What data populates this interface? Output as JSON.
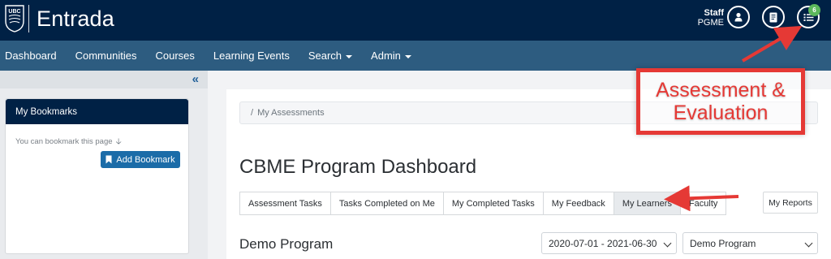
{
  "header": {
    "logo_text": "UBC",
    "brand": "Entrada",
    "user_name": "Staff",
    "user_role": "PGME",
    "notification_count": "6",
    "icons": [
      "user-icon",
      "document-icon",
      "task-list-icon"
    ]
  },
  "nav": {
    "items": [
      {
        "label": "Dashboard"
      },
      {
        "label": "Communities"
      },
      {
        "label": "Courses"
      },
      {
        "label": "Learning Events"
      },
      {
        "label": "Search",
        "dropdown": true
      },
      {
        "label": "Admin",
        "dropdown": true
      }
    ]
  },
  "sidebar": {
    "bookmarks_title": "My Bookmarks",
    "bookmarks_hint": "You can bookmark this page",
    "add_bookmark_label": "Add Bookmark"
  },
  "main": {
    "breadcrumb": "My Assessments",
    "page_title": "CBME Program Dashboard",
    "tabs": [
      {
        "label": "Assessment Tasks"
      },
      {
        "label": "Tasks Completed on Me"
      },
      {
        "label": "My Completed Tasks"
      },
      {
        "label": "My Feedback"
      },
      {
        "label": "My Learners",
        "active": true
      },
      {
        "label": "Faculty"
      }
    ],
    "reports_label": "My Reports",
    "program_title": "Demo Program",
    "date_range_selected": "2020-07-01 - 2021-06-30",
    "program_selected": "Demo Program"
  },
  "annotation": {
    "line1": "Assessment &",
    "line2": "Evaluation",
    "color": "#e53935"
  }
}
